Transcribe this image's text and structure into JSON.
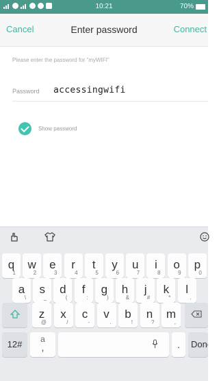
{
  "status_bar": {
    "time": "10:21",
    "battery": "70%"
  },
  "header": {
    "cancel_label": "Cancel",
    "title": "Enter password",
    "connect_label": "Connect"
  },
  "hint": "Please enter the password for \"myWIFI\"",
  "password": {
    "label": "Password",
    "value": "accessingwifi"
  },
  "show_password": {
    "label": "Show password",
    "checked": true
  },
  "keyboard": {
    "row1": [
      {
        "k": "q",
        "s": "1"
      },
      {
        "k": "w",
        "s": "2"
      },
      {
        "k": "e",
        "s": "3"
      },
      {
        "k": "r",
        "s": "4"
      },
      {
        "k": "t",
        "s": "5"
      },
      {
        "k": "y",
        "s": "6"
      },
      {
        "k": "u",
        "s": "7"
      },
      {
        "k": "i",
        "s": "8"
      },
      {
        "k": "o",
        "s": "9"
      },
      {
        "k": "p",
        "s": "0"
      }
    ],
    "row2": [
      {
        "k": "a",
        "s": "\\"
      },
      {
        "k": "s",
        "s": "_"
      },
      {
        "k": "d",
        "s": "("
      },
      {
        "k": "f",
        "s": ":"
      },
      {
        "k": "g",
        "s": ")"
      },
      {
        "k": "h",
        "s": "&"
      },
      {
        "k": "j",
        "s": "#"
      },
      {
        "k": "k",
        "s": "*"
      },
      {
        "k": "l",
        "s": "."
      }
    ],
    "row3": [
      {
        "k": "z",
        "s": "@"
      },
      {
        "k": "x",
        "s": "/"
      },
      {
        "k": "c",
        "s": "-"
      },
      {
        "k": "v",
        "s": "."
      },
      {
        "k": "b",
        "s": "!"
      },
      {
        "k": "n",
        "s": "?"
      },
      {
        "k": "m",
        "s": ","
      }
    ],
    "symbols_label": "12#",
    "a_key": {
      "k": "a",
      "s": ","
    },
    "period_label": ".",
    "done_label": "Done"
  }
}
